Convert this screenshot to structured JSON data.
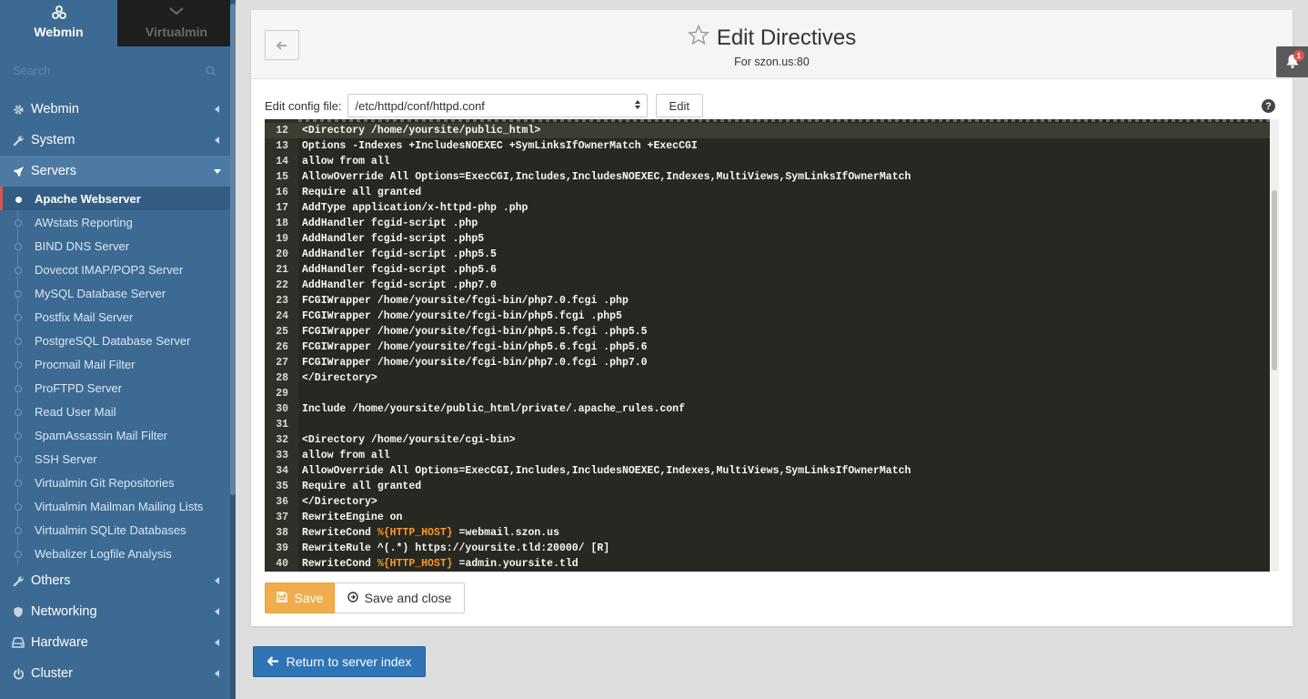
{
  "sidebar": {
    "tabs": [
      {
        "label": "Webmin",
        "icon": "webmin-logo-icon"
      },
      {
        "label": "Virtualmin",
        "icon": "chevron-down-icon"
      }
    ],
    "search_placeholder": "Search",
    "categories_top": [
      {
        "label": "Webmin",
        "icon": "gear-icon"
      },
      {
        "label": "System",
        "icon": "wrench-icon"
      },
      {
        "label": "Servers",
        "icon": "rocket-icon"
      }
    ],
    "servers_items": [
      "Apache Webserver",
      "AWstats Reporting",
      "BIND DNS Server",
      "Dovecot IMAP/POP3 Server",
      "MySQL Database Server",
      "Postfix Mail Server",
      "PostgreSQL Database Server",
      "Procmail Mail Filter",
      "ProFTPD Server",
      "Read User Mail",
      "SpamAssassin Mail Filter",
      "SSH Server",
      "Virtualmin Git Repositories",
      "Virtualmin Mailman Mailing Lists",
      "Virtualmin SQLite Databases",
      "Webalizer Logfile Analysis"
    ],
    "active_item": "Apache Webserver",
    "categories_bottom": [
      {
        "label": "Others",
        "icon": "wrench-icon"
      },
      {
        "label": "Networking",
        "icon": "shield-icon"
      },
      {
        "label": "Hardware",
        "icon": "hdd-icon"
      },
      {
        "label": "Cluster",
        "icon": "power-icon"
      }
    ]
  },
  "header": {
    "title": "Edit Directives",
    "subtitle": "For szon.us:80"
  },
  "config": {
    "label": "Edit config file:",
    "selected_file": "/etc/httpd/conf/httpd.conf",
    "edit_label": "Edit"
  },
  "editor": {
    "lines": [
      {
        "n": "12",
        "t": "<Directory /home/yoursite/public_html>"
      },
      {
        "n": "13",
        "t": "Options -Indexes +IncludesNOEXEC +SymLinksIfOwnerMatch +ExecCGI"
      },
      {
        "n": "14",
        "t": "allow from all"
      },
      {
        "n": "15",
        "t": "AllowOverride All Options=ExecCGI,Includes,IncludesNOEXEC,Indexes,MultiViews,SymLinksIfOwnerMatch"
      },
      {
        "n": "16",
        "t": "Require all granted"
      },
      {
        "n": "17",
        "t": "AddType application/x-httpd-php .php"
      },
      {
        "n": "18",
        "t": "AddHandler fcgid-script .php"
      },
      {
        "n": "19",
        "t": "AddHandler fcgid-script .php5"
      },
      {
        "n": "20",
        "t": "AddHandler fcgid-script .php5.5"
      },
      {
        "n": "21",
        "t": "AddHandler fcgid-script .php5.6"
      },
      {
        "n": "22",
        "t": "AddHandler fcgid-script .php7.0"
      },
      {
        "n": "23",
        "t": "FCGIWrapper /home/yoursite/fcgi-bin/php7.0.fcgi .php"
      },
      {
        "n": "24",
        "t": "FCGIWrapper /home/yoursite/fcgi-bin/php5.fcgi .php5"
      },
      {
        "n": "25",
        "t": "FCGIWrapper /home/yoursite/fcgi-bin/php5.5.fcgi .php5.5"
      },
      {
        "n": "26",
        "t": "FCGIWrapper /home/yoursite/fcgi-bin/php5.6.fcgi .php5.6"
      },
      {
        "n": "27",
        "t": "FCGIWrapper /home/yoursite/fcgi-bin/php7.0.fcgi .php7.0"
      },
      {
        "n": "28",
        "t": "</Directory>"
      },
      {
        "n": "29",
        "t": ""
      },
      {
        "n": "30",
        "t": "Include /home/yoursite/public_html/private/.apache_rules.conf"
      },
      {
        "n": "31",
        "t": ""
      },
      {
        "n": "32",
        "t": "<Directory /home/yoursite/cgi-bin>"
      },
      {
        "n": "33",
        "t": "allow from all"
      },
      {
        "n": "34",
        "t": "AllowOverride All Options=ExecCGI,Includes,IncludesNOEXEC,Indexes,MultiViews,SymLinksIfOwnerMatch"
      },
      {
        "n": "35",
        "t": "Require all granted"
      },
      {
        "n": "36",
        "t": "</Directory>"
      },
      {
        "n": "37",
        "t": "RewriteEngine on"
      },
      {
        "n": "38",
        "t": "RewriteCond ",
        "v": "%{HTTP_HOST}",
        "t2": " =webmail.szon.us"
      },
      {
        "n": "39",
        "t": "RewriteRule ^(.*) https://yoursite.tld:20000/ [R]"
      },
      {
        "n": "40",
        "t": "RewriteCond ",
        "v": "%{HTTP_HOST}",
        "t2": " =admin.yoursite.tld"
      }
    ]
  },
  "buttons": {
    "save_label": "Save",
    "save_close_label": "Save and close",
    "return_label": "Return to server index"
  },
  "notifications": {
    "count": "1"
  },
  "colors": {
    "sidebar_bg": "#3c6a93",
    "editor_bg": "#272822",
    "save_btn": "#f0ad4e",
    "return_btn": "#2f74b5",
    "variable": "#fd971f"
  }
}
